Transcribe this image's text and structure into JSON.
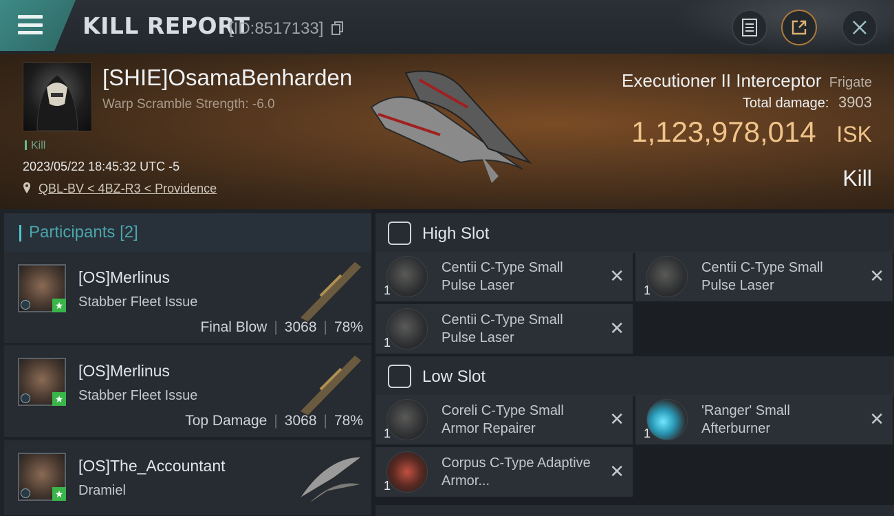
{
  "header": {
    "title": "KILL REPORT",
    "report_id": "[ID:8517133]"
  },
  "victim": {
    "name": "[SHIE]OsamaBenharden",
    "warp_scramble": "Warp Scramble Strength: -6.0",
    "tag": "Kill",
    "datetime": "2023/05/22 18:45:32 UTC -5",
    "location": "QBL-BV < 4BZ-R3 < Providence",
    "ship_name": "Executioner II Interceptor",
    "ship_class": "Frigate",
    "total_damage_label": "Total damage:",
    "total_damage": "3903",
    "isk_value": "1,123,978,014",
    "isk_unit": "ISK",
    "result": "Kill"
  },
  "participants": {
    "title": "Participants",
    "count": "[2]",
    "rows": [
      {
        "name": "[OS]Merlinus",
        "ship": "Stabber Fleet Issue",
        "role": "Final Blow",
        "damage": "3068",
        "percent": "78%"
      },
      {
        "name": "[OS]Merlinus",
        "ship": "Stabber Fleet Issue",
        "role": "Top Damage",
        "damage": "3068",
        "percent": "78%"
      },
      {
        "name": "[OS]The_Accountant",
        "ship": "Dramiel"
      }
    ]
  },
  "fitting": {
    "high_slot": {
      "label": "High Slot",
      "modules": [
        {
          "name": "Centii C-Type Small Pulse Laser",
          "qty": "1"
        },
        {
          "name": "Centii C-Type Small Pulse Laser",
          "qty": "1"
        },
        {
          "name": "Centii C-Type Small Pulse Laser",
          "qty": "1"
        }
      ]
    },
    "low_slot": {
      "label": "Low Slot",
      "modules": [
        {
          "name": "Coreli C-Type Small Armor Repairer",
          "qty": "1"
        },
        {
          "name": "'Ranger' Small Afterburner",
          "qty": "1"
        },
        {
          "name": "Corpus C-Type Adaptive Armor...",
          "qty": "1"
        }
      ]
    },
    "remove_glyph": "✕"
  },
  "colors": {
    "accent_teal": "#3e8a86",
    "isk_gold": "#f0c48a",
    "participants_title": "#4ba6ad",
    "star_green": "#39b54a"
  },
  "icons": [
    "menu-icon",
    "copy-icon",
    "notes-icon",
    "share-icon",
    "close-icon",
    "location-pin-icon",
    "slot-icon",
    "remove-icon",
    "star-icon"
  ]
}
